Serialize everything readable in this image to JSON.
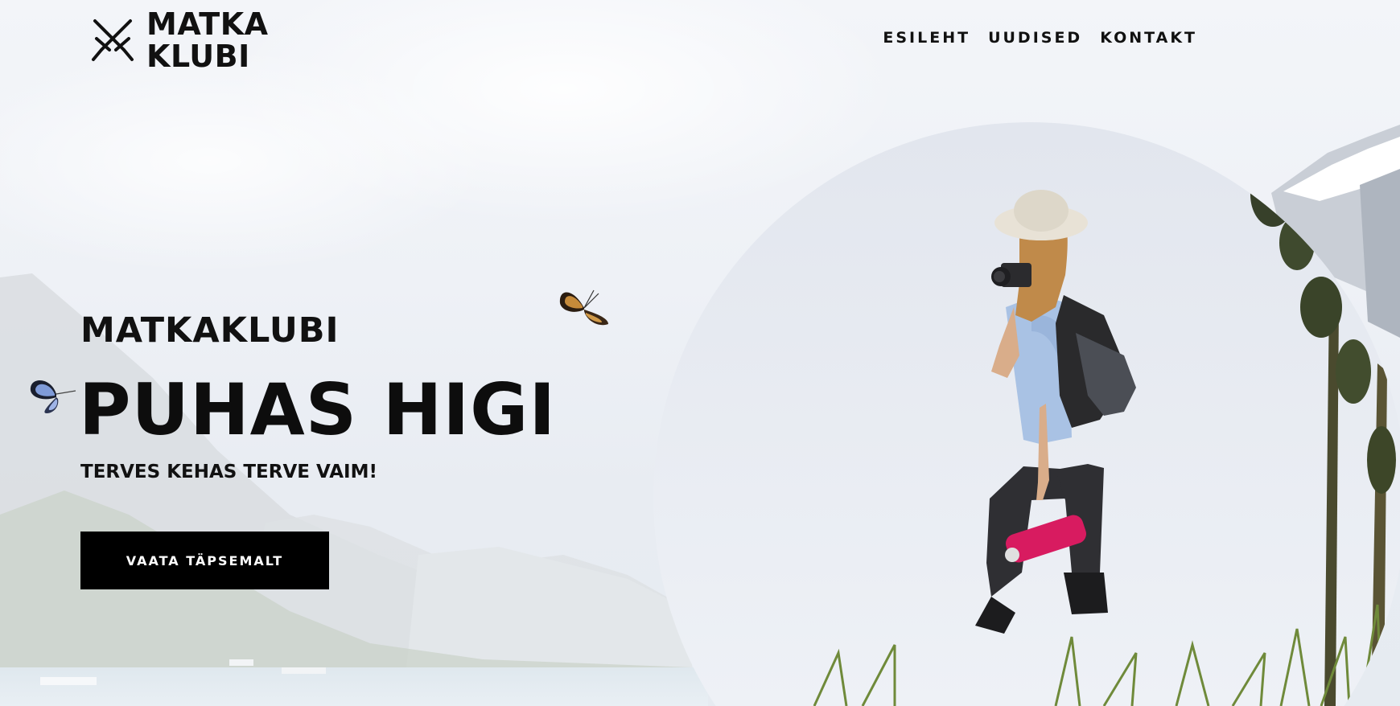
{
  "logo": {
    "line1": "MATKA",
    "line2": "KLUBI",
    "icon": "crossed-swords-icon"
  },
  "nav": {
    "items": [
      "ESILEHT",
      "UUDISED",
      "KONTAKT"
    ]
  },
  "hero": {
    "kicker": "MATKAKLUBI",
    "headline": "PUHAS HIGI",
    "subline": "TERVES KEHAS TERVE VAIM!",
    "cta_label": "VAATA TÄPSEMALT"
  },
  "colors": {
    "text": "#111111",
    "button_bg": "#000000",
    "button_text": "#ffffff",
    "bottle": "#d81b60"
  }
}
